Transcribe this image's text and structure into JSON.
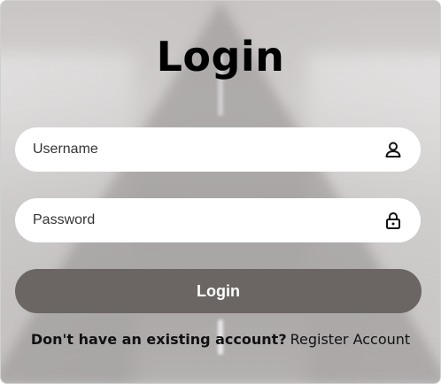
{
  "login_form": {
    "title": "Login",
    "username": {
      "placeholder": "Username",
      "icon": "user-icon"
    },
    "password": {
      "placeholder": "Password",
      "icon": "lock-icon"
    },
    "submit_label": "Login",
    "register_prompt": "Don't have an existing account?",
    "register_link": "Register Account"
  },
  "colors": {
    "button": "#6b6564",
    "field_background": "#ffffff",
    "text": "#000000"
  }
}
